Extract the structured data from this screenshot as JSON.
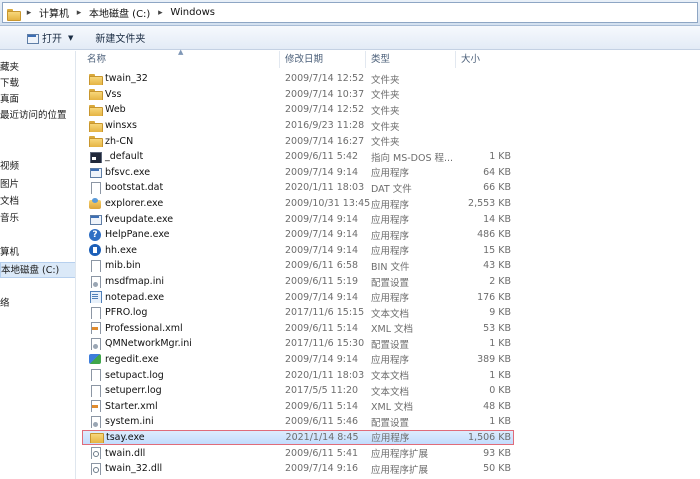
{
  "address": {
    "crumbs": [
      "计算机",
      "本地磁盘 (C:)",
      "Windows"
    ],
    "separator": "▸"
  },
  "toolbar": {
    "open_label": "打开",
    "open_arrow": "▼",
    "new_folder_label": "新建文件夹"
  },
  "nav": {
    "items": [
      "藏夹",
      "下载",
      "真面",
      "最近访问的位置",
      "视频",
      "图片",
      "文档",
      "音乐",
      "算机",
      "本地磁盘 (C:)",
      "络"
    ],
    "selected": "本地磁盘 (C:)"
  },
  "columns": {
    "name": "名称",
    "date": "修改日期",
    "type": "类型",
    "size": "大小",
    "sort_arrow": "▲"
  },
  "files": [
    {
      "name": "twain_32",
      "date": "2009/7/14 12:52",
      "type": "文件夹",
      "size": "",
      "icon": "folder-icon"
    },
    {
      "name": "Vss",
      "date": "2009/7/14 10:37",
      "type": "文件夹",
      "size": "",
      "icon": "folder-icon"
    },
    {
      "name": "Web",
      "date": "2009/7/14 12:52",
      "type": "文件夹",
      "size": "",
      "icon": "folder-icon"
    },
    {
      "name": "winsxs",
      "date": "2016/9/23 11:28",
      "type": "文件夹",
      "size": "",
      "icon": "folder-icon"
    },
    {
      "name": "zh-CN",
      "date": "2009/7/14 16:27",
      "type": "文件夹",
      "size": "",
      "icon": "folder-icon"
    },
    {
      "name": "_default",
      "date": "2009/6/11 5:42",
      "type": "指向 MS-DOS 程...",
      "size": "1 KB",
      "icon": "shortcut-icon"
    },
    {
      "name": "bfsvc.exe",
      "date": "2009/7/14 9:14",
      "type": "应用程序",
      "size": "64 KB",
      "icon": "exe-icon"
    },
    {
      "name": "bootstat.dat",
      "date": "2020/1/11 18:03",
      "type": "DAT 文件",
      "size": "66 KB",
      "icon": "file-icon"
    },
    {
      "name": "explorer.exe",
      "date": "2009/10/31 13:45",
      "type": "应用程序",
      "size": "2,553 KB",
      "icon": "explorer-icon"
    },
    {
      "name": "fveupdate.exe",
      "date": "2009/7/14 9:14",
      "type": "应用程序",
      "size": "14 KB",
      "icon": "exe-icon"
    },
    {
      "name": "HelpPane.exe",
      "date": "2009/7/14 9:14",
      "type": "应用程序",
      "size": "486 KB",
      "icon": "help-icon"
    },
    {
      "name": "hh.exe",
      "date": "2009/7/14 9:14",
      "type": "应用程序",
      "size": "15 KB",
      "icon": "hh-icon"
    },
    {
      "name": "mib.bin",
      "date": "2009/6/11 6:58",
      "type": "BIN 文件",
      "size": "43 KB",
      "icon": "file-icon"
    },
    {
      "name": "msdfmap.ini",
      "date": "2009/6/11 5:19",
      "type": "配置设置",
      "size": "2 KB",
      "icon": "ini-icon"
    },
    {
      "name": "notepad.exe",
      "date": "2009/7/14 9:14",
      "type": "应用程序",
      "size": "176 KB",
      "icon": "notepad-icon"
    },
    {
      "name": "PFRO.log",
      "date": "2017/11/6 15:15",
      "type": "文本文档",
      "size": "9 KB",
      "icon": "file-icon"
    },
    {
      "name": "Professional.xml",
      "date": "2009/6/11 5:14",
      "type": "XML 文档",
      "size": "53 KB",
      "icon": "xml-icon"
    },
    {
      "name": "QMNetworkMgr.ini",
      "date": "2017/11/6 15:30",
      "type": "配置设置",
      "size": "1 KB",
      "icon": "ini-icon"
    },
    {
      "name": "regedit.exe",
      "date": "2009/7/14 9:14",
      "type": "应用程序",
      "size": "389 KB",
      "icon": "regedit-icon"
    },
    {
      "name": "setupact.log",
      "date": "2020/1/11 18:03",
      "type": "文本文档",
      "size": "1 KB",
      "icon": "file-icon"
    },
    {
      "name": "setuperr.log",
      "date": "2017/5/5 11:20",
      "type": "文本文档",
      "size": "0 KB",
      "icon": "file-icon"
    },
    {
      "name": "Starter.xml",
      "date": "2009/6/11 5:14",
      "type": "XML 文档",
      "size": "48 KB",
      "icon": "xml-icon"
    },
    {
      "name": "system.ini",
      "date": "2009/6/11 5:46",
      "type": "配置设置",
      "size": "1 KB",
      "icon": "ini-icon"
    },
    {
      "name": "tsay.exe",
      "date": "2021/1/14 8:45",
      "type": "应用程序",
      "size": "1,506 KB",
      "icon": "tsay-icon",
      "selected": true
    },
    {
      "name": "twain.dll",
      "date": "2009/6/11 5:41",
      "type": "应用程序扩展",
      "size": "93 KB",
      "icon": "dll-icon"
    },
    {
      "name": "twain_32.dll",
      "date": "2009/7/14 9:16",
      "type": "应用程序扩展",
      "size": "50 KB",
      "icon": "dll-icon"
    }
  ]
}
